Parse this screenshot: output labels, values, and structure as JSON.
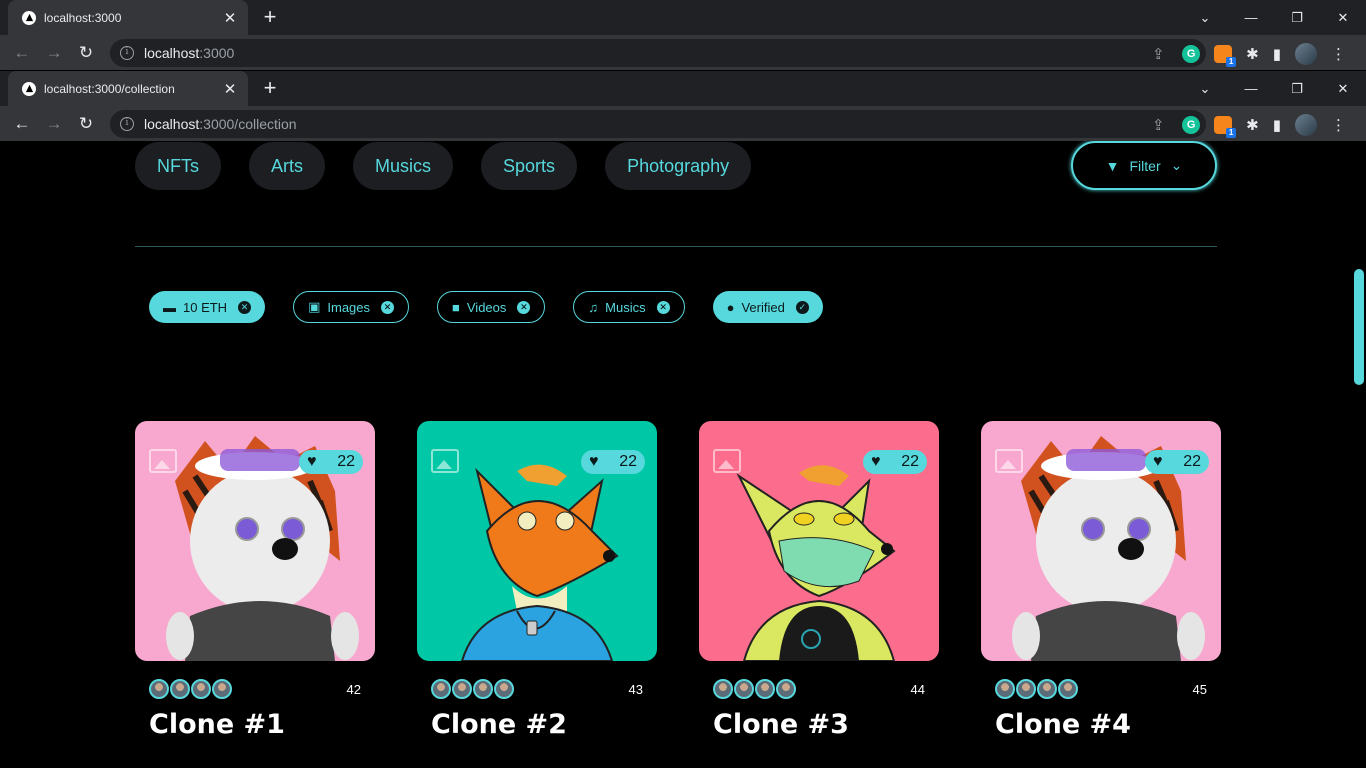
{
  "windows": [
    {
      "tab_title": "localhost:3000",
      "url_host": "localhost",
      "url_rest": ":3000"
    },
    {
      "tab_title": "localhost:3000/collection",
      "url_host": "localhost",
      "url_rest": ":3000/collection"
    }
  ],
  "categories": [
    "NFTs",
    "Arts",
    "Musics",
    "Sports",
    "Photography"
  ],
  "filter_label": "Filter",
  "chips": [
    {
      "label": "10 ETH",
      "active": true
    },
    {
      "label": "Images",
      "active": false
    },
    {
      "label": "Videos",
      "active": false
    },
    {
      "label": "Musics",
      "active": false
    },
    {
      "label": "Verified",
      "active": true
    }
  ],
  "cards": [
    {
      "name": "Clone #1",
      "likes": "22",
      "count": "42",
      "bg": "#f8a8cf"
    },
    {
      "name": "Clone #2",
      "likes": "22",
      "count": "43",
      "bg": "#00c7a5"
    },
    {
      "name": "Clone #3",
      "likes": "22",
      "count": "44",
      "bg": "#fc6c8c"
    },
    {
      "name": "Clone #4",
      "likes": "22",
      "count": "45",
      "bg": "#f8a8cf"
    }
  ],
  "colors": {
    "accent": "#56d8dd",
    "background": "#000000"
  }
}
